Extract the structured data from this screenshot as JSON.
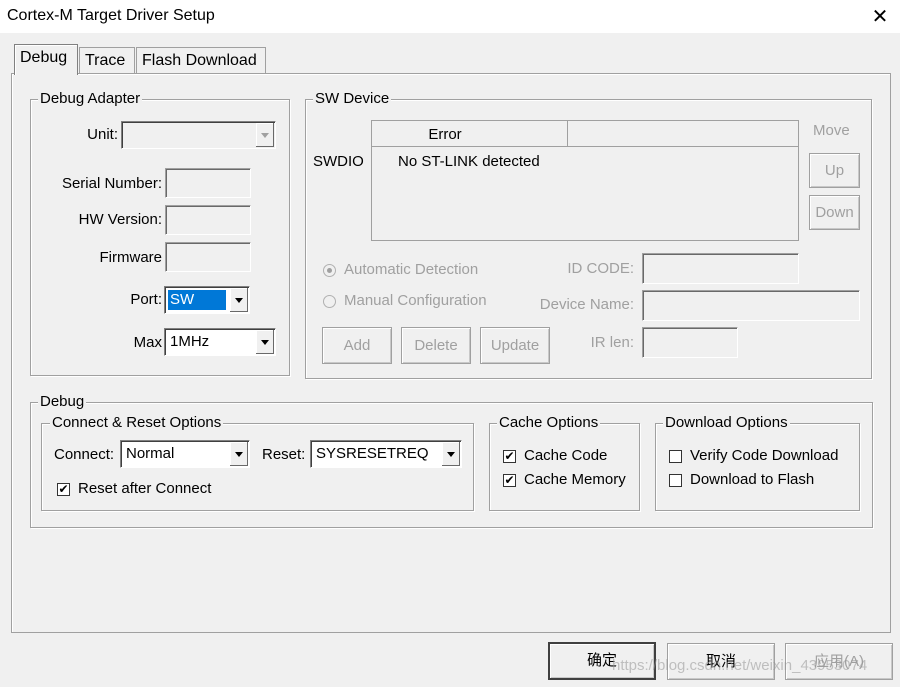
{
  "window": {
    "title": "Cortex-M Target Driver Setup",
    "close_glyph": "✕"
  },
  "tabs": [
    {
      "label": "Debug",
      "active": true
    },
    {
      "label": "Trace",
      "active": false
    },
    {
      "label": "Flash Download",
      "active": false
    }
  ],
  "debug_adapter": {
    "legend": "Debug Adapter",
    "unit_label": "Unit:",
    "unit_value": "",
    "serial_label": "Serial Number:",
    "serial_value": "",
    "hw_label": "HW Version:",
    "hw_value": "",
    "firmware_label": "Firmware",
    "firmware_value": "",
    "port_label": "Port:",
    "port_value": "SW",
    "max_label": "Max",
    "max_value": "1MHz"
  },
  "sw_device": {
    "legend": "SW Device",
    "swdio_label": "SWDIO",
    "table_header": "Error",
    "table_row": "No ST-LINK detected",
    "move_label": "Move",
    "up_button": "Up",
    "down_button": "Down",
    "auto_detection": "Automatic Detection",
    "manual_config": "Manual Configuration",
    "selected_mode": "auto",
    "id_code_label": "ID CODE:",
    "device_name_label": "Device Name:",
    "ir_len_label": "IR len:",
    "add_button": "Add",
    "delete_button": "Delete",
    "update_button": "Update"
  },
  "debug": {
    "legend": "Debug",
    "connect_reset": {
      "legend": "Connect & Reset Options",
      "connect_label": "Connect:",
      "connect_value": "Normal",
      "reset_label": "Reset:",
      "reset_value": "SYSRESETREQ",
      "reset_after_connect": "Reset after Connect",
      "reset_after_connect_checked": true
    },
    "cache": {
      "legend": "Cache Options",
      "cache_code": "Cache Code",
      "cache_code_checked": true,
      "cache_memory": "Cache Memory",
      "cache_memory_checked": true
    },
    "download": {
      "legend": "Download Options",
      "verify": "Verify Code Download",
      "verify_checked": false,
      "download_flash": "Download to Flash",
      "download_flash_checked": false
    }
  },
  "footer": {
    "ok_button": "确定",
    "cancel_button": "取消",
    "apply_button": "应用(A)",
    "watermark": "https://blog.csdn.net/weixin_43953074"
  },
  "check_glyph": "✔"
}
